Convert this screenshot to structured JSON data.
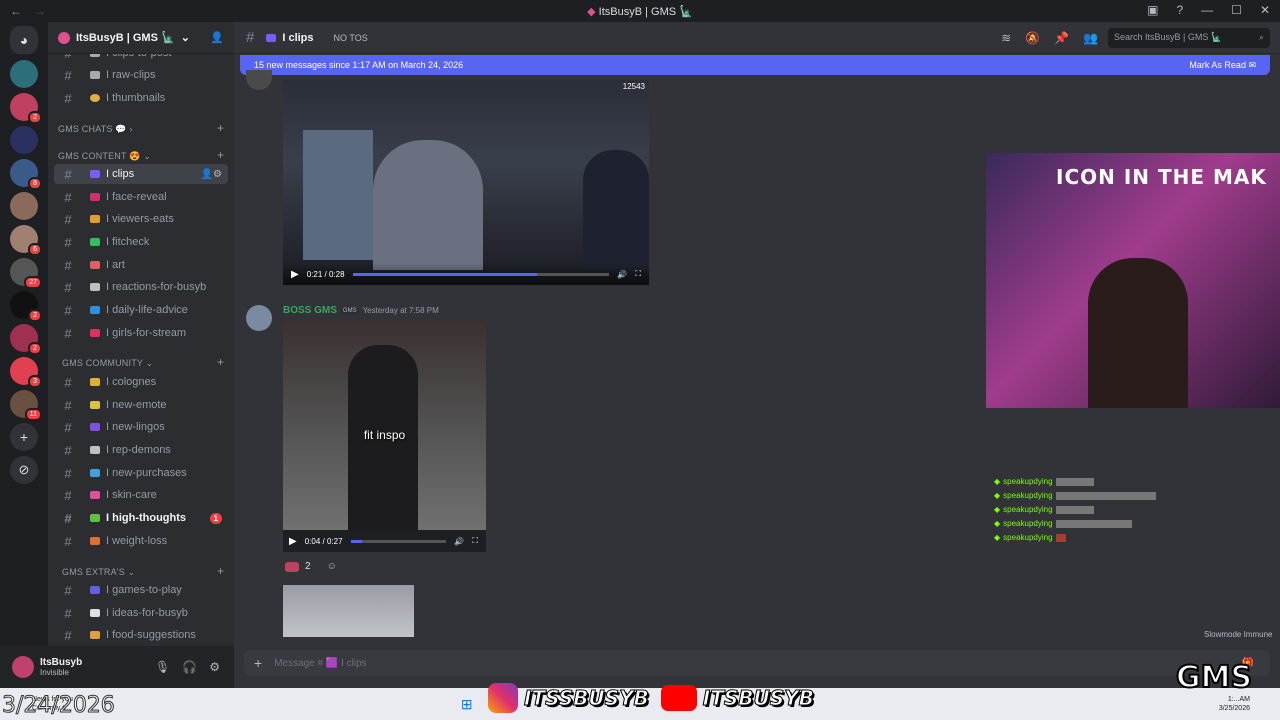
{
  "window": {
    "title": "ItsBusyB | GMS 🗽"
  },
  "server": {
    "name": "ItsBusyB | GMS 🗽"
  },
  "server_badges": [
    "2",
    "8",
    "6",
    "27",
    "2",
    "2",
    "3",
    "11"
  ],
  "channels_top": [
    {
      "name": "I clips-to-post"
    },
    {
      "name": "I raw-clips"
    },
    {
      "name": "I thumbnails"
    }
  ],
  "categories": {
    "chats": "GMS CHATS 💬",
    "content": "GMS CONTENT 😍",
    "community": "GMS COMMUNITY",
    "extras": "GMS EXTRA'S"
  },
  "content_channels": [
    {
      "name": "I clips",
      "color": "#7a5cff"
    },
    {
      "name": "I face-reveal",
      "color": "#d03070"
    },
    {
      "name": "I viewers-eats",
      "color": "#e0a030"
    },
    {
      "name": "I fitcheck",
      "color": "#30c060"
    },
    {
      "name": "I art",
      "color": "#e06060"
    },
    {
      "name": "I reactions-for-busyb",
      "color": "#c0c0c0"
    },
    {
      "name": "I daily-life-advice",
      "color": "#3090e0"
    },
    {
      "name": "I girls-for-stream",
      "color": "#e03060"
    }
  ],
  "community_channels": [
    {
      "name": "I colognes",
      "color": "#e0b030"
    },
    {
      "name": "I new-emote",
      "color": "#e0c040"
    },
    {
      "name": "I new-lingos",
      "color": "#8050e0"
    },
    {
      "name": "I rep-demons",
      "color": "#c0c0c0"
    },
    {
      "name": "I new-purchases",
      "color": "#40a0e0"
    },
    {
      "name": "I skin-care",
      "color": "#e050a0"
    },
    {
      "name": "I high-thoughts",
      "color": "#60c040",
      "unread": "1"
    },
    {
      "name": "I weight-loss",
      "color": "#e07030"
    }
  ],
  "extras_channels": [
    {
      "name": "I games-to-play",
      "color": "#6060e0"
    },
    {
      "name": "I ideas-for-busyb",
      "color": "#e0e0e0"
    },
    {
      "name": "I food-suggestions",
      "color": "#e0a040"
    }
  ],
  "user": {
    "name": "ItsBusyb",
    "status": "Invisible"
  },
  "header": {
    "channel": "I clips",
    "topic": "NO TOS",
    "search_placeholder": "Search ItsBusyB | GMS 🗽"
  },
  "new_messages": {
    "text": "15 new messages since 1:17 AM on March 24, 2026",
    "action": "Mark As Read"
  },
  "video1": {
    "time": "0:21 / 0:28",
    "progress": 0.72,
    "overlay": "12543"
  },
  "message": {
    "author": "BOSS GMS",
    "author_color": "#3ba55d",
    "tag": "GMS",
    "timestamp": "Yesterday at 7:58 PM"
  },
  "video2": {
    "time": "0:04 / 0:27",
    "progress": 0.12,
    "caption": "fit inspo"
  },
  "reaction": {
    "count": "2"
  },
  "chat_lines": [
    {
      "user": "speakupdying",
      "color": "#7cfc00"
    },
    {
      "user": "speakupdying",
      "color": "#7cfc00"
    },
    {
      "user": "speakupdying",
      "color": "#7cfc00"
    },
    {
      "user": "speakupdying",
      "color": "#7cfc00"
    },
    {
      "user": "speakupdying",
      "color": "#7cfc00"
    }
  ],
  "webcam": {
    "banner": "ICON IN THE MAK"
  },
  "slowmode": "Slowmode Immune",
  "composer": {
    "placeholder": "Message # 🟪 I clips"
  },
  "overlay": {
    "date": "3/24/2026",
    "news": "News for you",
    "news_sub": "Currently tr..."
  },
  "socials": {
    "instagram": "ITSSBUSYB",
    "youtube": "ITSBUSYB",
    "logo": "GMS"
  },
  "tray": {
    "time": "1:...AM",
    "date": "3/25/2026"
  }
}
